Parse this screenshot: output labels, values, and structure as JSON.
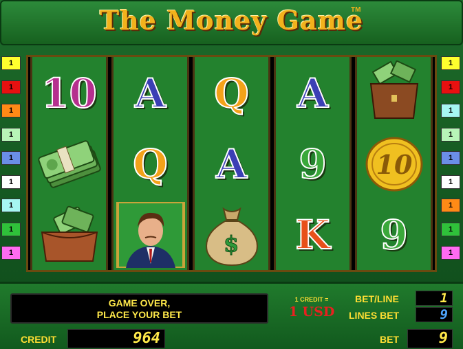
{
  "title": {
    "text": "The Money Game",
    "tm": "TM"
  },
  "markers_left": [
    {
      "label": "1",
      "color": "#ffff2e"
    },
    {
      "label": "1",
      "color": "#e81010"
    },
    {
      "label": "1",
      "color": "#ff8a16"
    },
    {
      "label": "1",
      "color": "#b7f5b7"
    },
    {
      "label": "1",
      "color": "#6b8ee8"
    },
    {
      "label": "1",
      "color": "#ffffff"
    },
    {
      "label": "1",
      "color": "#a6f6f2"
    },
    {
      "label": "1",
      "color": "#2fc13a"
    },
    {
      "label": "1",
      "color": "#ff6bf1"
    }
  ],
  "markers_right": [
    {
      "label": "1",
      "color": "#ffff2e"
    },
    {
      "label": "1",
      "color": "#e81010"
    },
    {
      "label": "1",
      "color": "#a6f6f2"
    },
    {
      "label": "1",
      "color": "#b7f5b7"
    },
    {
      "label": "1",
      "color": "#6b8ee8"
    },
    {
      "label": "1",
      "color": "#ffffff"
    },
    {
      "label": "1",
      "color": "#ff8a16"
    },
    {
      "label": "1",
      "color": "#2fc13a"
    },
    {
      "label": "1",
      "color": "#ff6bf1"
    }
  ],
  "reels": [
    [
      "10",
      "cash-stack",
      "wallet"
    ],
    [
      "A",
      "Q",
      "businessman"
    ],
    [
      "Q",
      "A",
      "money-bag"
    ],
    [
      "A",
      "9",
      "K"
    ],
    [
      "money-briefcase",
      "gold-coin-10",
      "9"
    ]
  ],
  "symbol_styles": {
    "10": {
      "fill": "#b5308e",
      "stroke": "#ffffff"
    },
    "A": {
      "fill": "#3b3fb5",
      "stroke": "#ffffff"
    },
    "Q": {
      "fill": "#f3a21a",
      "stroke": "#ffffff"
    },
    "9": {
      "fill": "#3aa83a",
      "stroke": "#ffffff"
    },
    "K": {
      "fill": "#e8501a",
      "stroke": "#ffffff"
    }
  },
  "coin_text": "10",
  "message": {
    "line1": "GAME OVER,",
    "line2": "PLACE YOUR BET"
  },
  "credit_rate": {
    "label": "1 CREDIT =",
    "value": "1 USD"
  },
  "bet_line": {
    "label": "BET/LINE",
    "value": "1"
  },
  "lines_bet": {
    "label": "LINES BET",
    "value": "9"
  },
  "credit": {
    "label": "CREDIT",
    "value": "964"
  },
  "bet": {
    "label": "BET",
    "value": "9"
  }
}
